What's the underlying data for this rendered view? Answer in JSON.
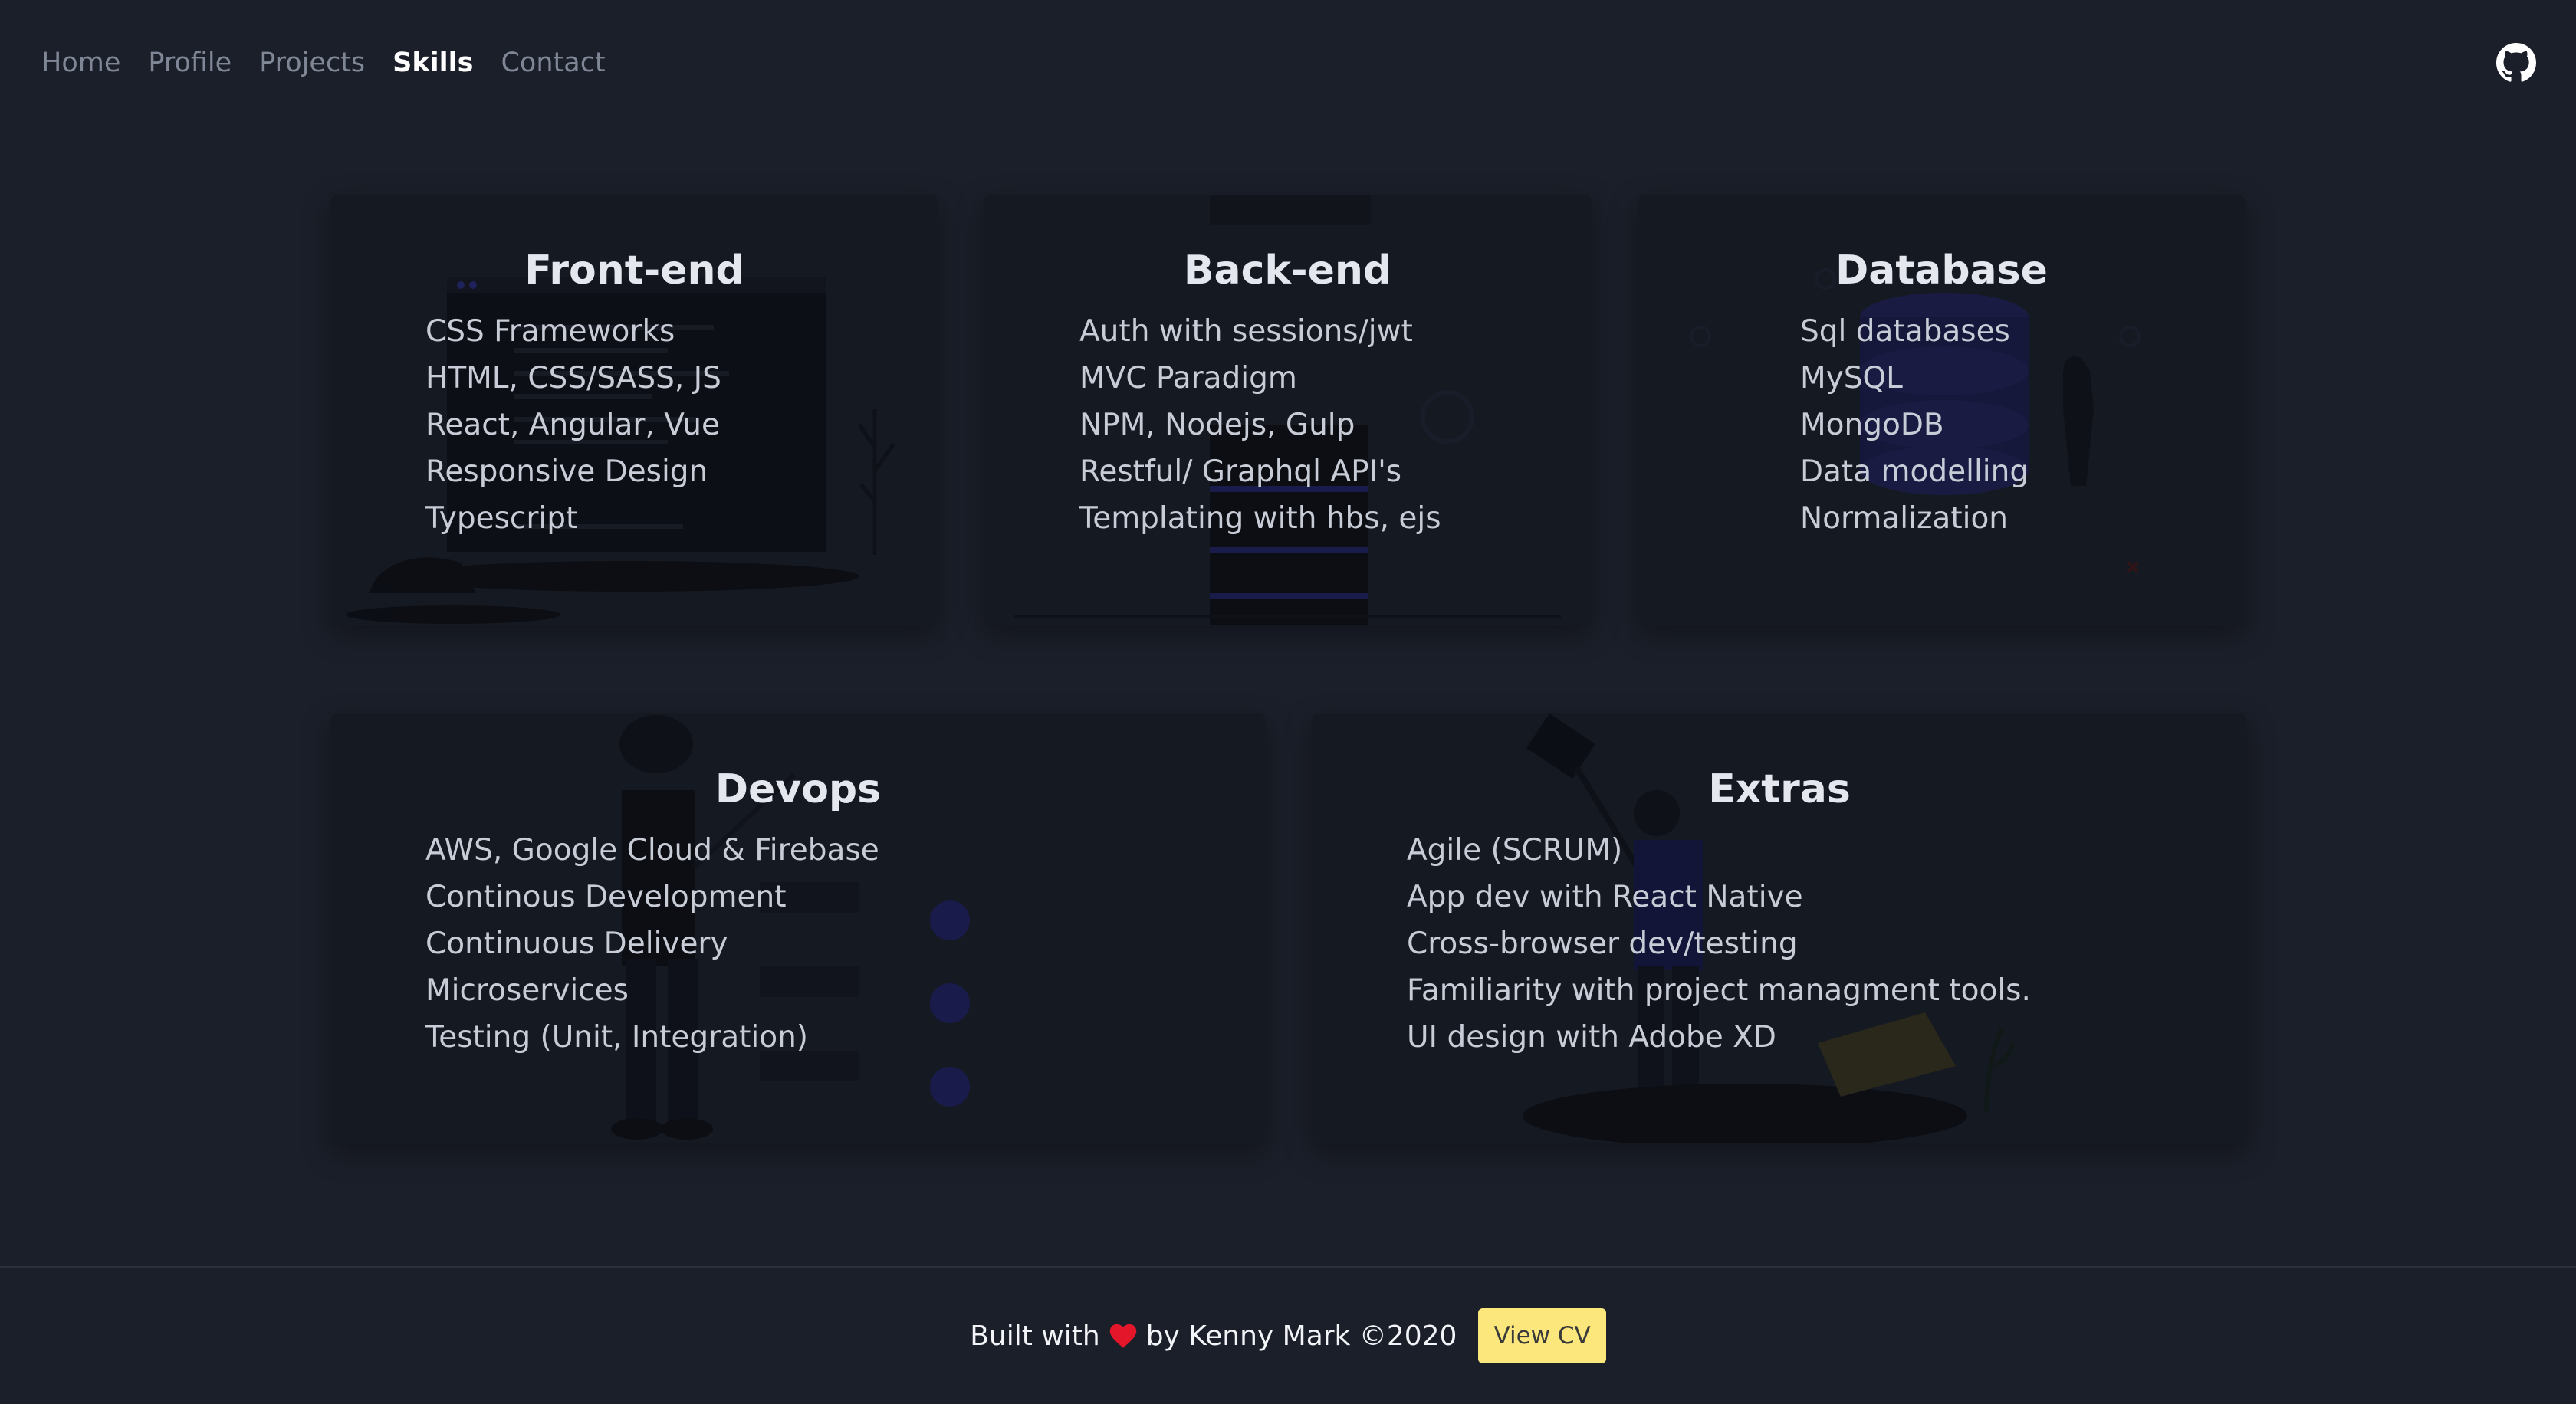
{
  "nav": {
    "links": [
      {
        "label": "Home"
      },
      {
        "label": "Profile"
      },
      {
        "label": "Projects"
      },
      {
        "label": "Skills"
      },
      {
        "label": "Contact"
      }
    ],
    "active": "Skills",
    "github_icon": "github-icon"
  },
  "cards": {
    "frontend": {
      "title": "Front-end",
      "items": [
        "CSS Frameworks",
        "HTML, CSS/SASS, JS",
        "React, Angular, Vue",
        "Responsive Design",
        "Typescript"
      ]
    },
    "backend": {
      "title": "Back-end",
      "items": [
        "Auth with sessions/jwt",
        "MVC Paradigm",
        "NPM, Nodejs, Gulp",
        "Restful/ Graphql API's",
        "Templating with hbs, ejs"
      ]
    },
    "database": {
      "title": "Database",
      "items": [
        "Sql databases",
        "MySQL",
        "MongoDB",
        "Data modelling",
        "Normalization"
      ]
    },
    "devops": {
      "title": "Devops",
      "items": [
        "AWS, Google Cloud & Firebase",
        "Continous Development",
        "Continuous Delivery",
        "Microservices",
        "Testing (Unit, Integration)"
      ]
    },
    "extras": {
      "title": "Extras",
      "items": [
        "Agile (SCRUM)",
        "App dev with React Native",
        "Cross-browser dev/testing",
        "Familiarity with project managment tools.",
        "UI design with Adobe XD"
      ]
    }
  },
  "footer": {
    "built_with": "Built with",
    "by": "by Kenny Mark ©2020",
    "heart_icon": "heart-icon",
    "cv_button": "View CV"
  },
  "colors": {
    "background": "#1b1f29",
    "card": "#151922",
    "accent_button": "#fbe77b",
    "heart": "#e3162a",
    "illustration_accent": "#2a2a8a"
  }
}
